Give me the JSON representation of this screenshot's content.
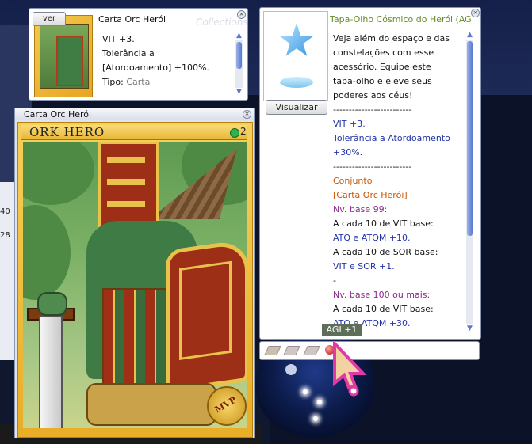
{
  "background": {
    "strip_numbers": [
      "40",
      "28"
    ],
    "accent_colors": {
      "window_border": "#8895b0",
      "scroll_blue": "#5a7ad0",
      "card_gold": "#e9ad27"
    }
  },
  "mini_card": {
    "view_button": "ver",
    "title": "Carta Orc Herói",
    "watermark": "Collections",
    "lines": [
      "VIT +3.",
      "Tolerância a",
      "[Atordoamento] +100%."
    ],
    "type_label": "Tipo:",
    "type_value": "Carta",
    "close_icon": "close-icon"
  },
  "card_window": {
    "title": "Carta Orc Herói",
    "card_name": "ORK HERO",
    "slot_count": "2",
    "badge": "MVP"
  },
  "item_window": {
    "title": "Tapa-Olho Cósmico do Herói (AG",
    "view_button": "Visualizar",
    "lines": [
      {
        "text": "Veja além do espaço e das",
        "color": "black"
      },
      {
        "text": "constelações com esse",
        "color": "black"
      },
      {
        "text": "acessório. Equipe este",
        "color": "black"
      },
      {
        "text": "tapa-olho e eleve seus",
        "color": "black"
      },
      {
        "text": "poderes aos céus!",
        "color": "black"
      },
      {
        "text": "-------------------------",
        "color": "black"
      },
      {
        "text": "VIT +3.",
        "color": "blue"
      },
      {
        "text": "Tolerância a Atordoamento",
        "color": "blue"
      },
      {
        "text": "+30%.",
        "color": "blue"
      },
      {
        "text": "-------------------------",
        "color": "black"
      },
      {
        "text": "Conjunto",
        "color": "orange"
      },
      {
        "text": "[Carta Orc Herói]",
        "color": "orange"
      },
      {
        "text": "Nv. base 99:",
        "color": "purple"
      },
      {
        "text": "A cada 10 de VIT base:",
        "color": "black"
      },
      {
        "text": "ATQ e ATQM +10.",
        "color": "blue"
      },
      {
        "text": "A cada 10 de SOR base:",
        "color": "black"
      },
      {
        "text": "VIT e SOR +1.",
        "color": "blue"
      },
      {
        "text": "-",
        "color": "black"
      },
      {
        "text": "Nv. base 100 ou mais:",
        "color": "purple"
      },
      {
        "text": "A cada 10 de VIT base:",
        "color": "black"
      },
      {
        "text": "ATQ e ATQM +30.",
        "color": "blue"
      }
    ]
  },
  "slot_bar": {
    "tooltip": "AGI +1"
  }
}
